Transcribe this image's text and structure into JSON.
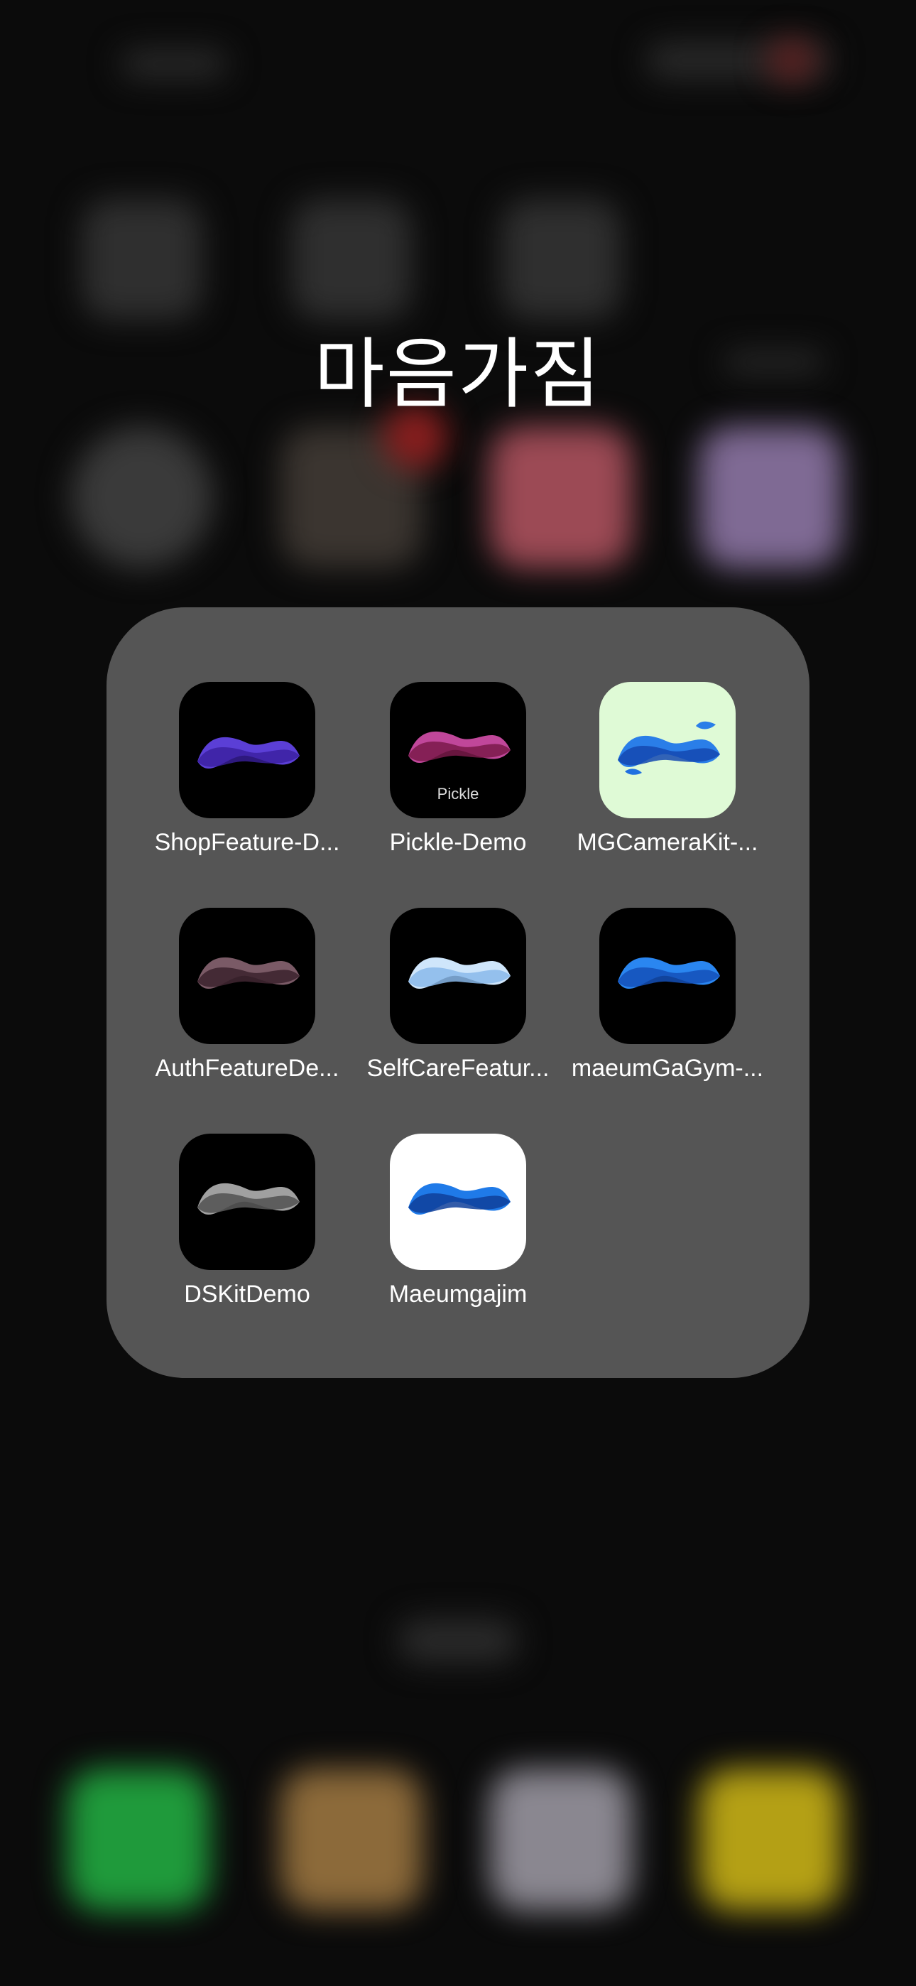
{
  "folder": {
    "title": "마음가짐",
    "apps": [
      {
        "name": "ShopFeature-D...",
        "icon": "purple-wave-icon",
        "bg": "#000000",
        "color": "#6a4bd8"
      },
      {
        "name": "Pickle-Demo",
        "icon": "magenta-wave-icon",
        "bg": "#000000",
        "color": "#b0408a",
        "badge_text": "Pickle"
      },
      {
        "name": "MGCameraKit-...",
        "icon": "blue-wave-camera-icon",
        "bg": "#dffad6",
        "color": "#2a7ee8"
      },
      {
        "name": "AuthFeatureDe...",
        "icon": "mauve-wave-icon",
        "bg": "#000000",
        "color": "#6a4a55"
      },
      {
        "name": "SelfCareFeatur...",
        "icon": "lightblue-wave-icon",
        "bg": "#000000",
        "color": "#b9d8f8"
      },
      {
        "name": "maeumGaGym-...",
        "icon": "blue-wave-icon",
        "bg": "#000000",
        "color": "#2a7ee8"
      },
      {
        "name": "DSKitDemo",
        "icon": "gray-wave-icon",
        "bg": "#000000",
        "color": "#9a9a9a"
      },
      {
        "name": "Maeumgajim",
        "icon": "blue-wave-white-icon",
        "bg": "#ffffff",
        "color": "#1f6fe0"
      }
    ]
  }
}
